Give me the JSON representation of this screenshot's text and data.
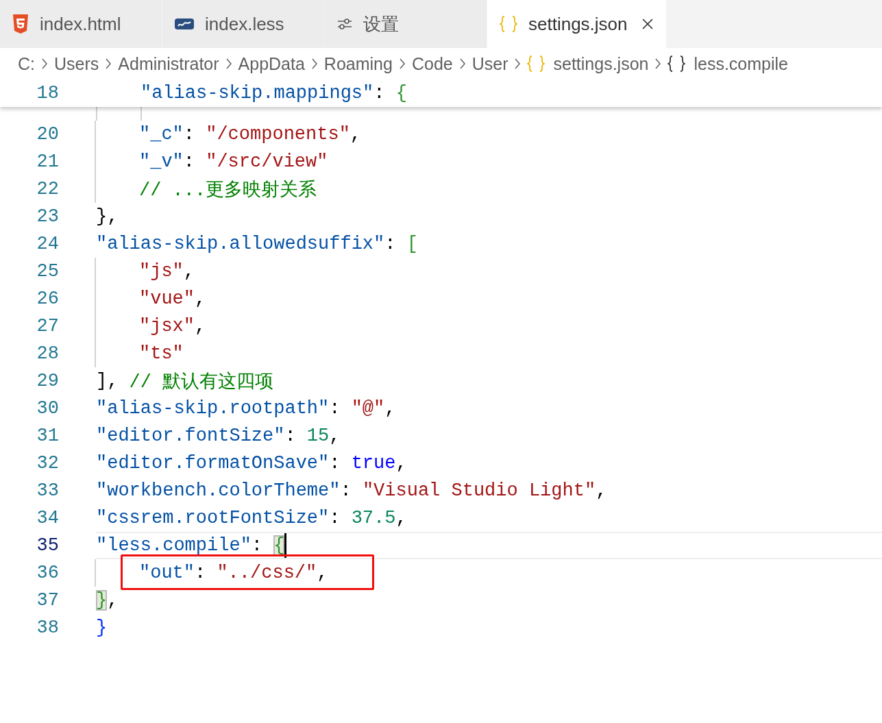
{
  "tabs": [
    {
      "label": "index.html",
      "kind": "html",
      "selected": false,
      "closable": false
    },
    {
      "label": "index.less",
      "kind": "less",
      "selected": false,
      "closable": false
    },
    {
      "label": "设置",
      "kind": "settings",
      "selected": false,
      "closable": false
    },
    {
      "label": "settings.json",
      "kind": "json",
      "selected": true,
      "closable": true
    }
  ],
  "breadcrumbs": [
    {
      "label": "C:",
      "kind": "folder"
    },
    {
      "label": "Users",
      "kind": "folder"
    },
    {
      "label": "Administrator",
      "kind": "folder"
    },
    {
      "label": "AppData",
      "kind": "folder"
    },
    {
      "label": "Roaming",
      "kind": "folder"
    },
    {
      "label": "Code",
      "kind": "folder"
    },
    {
      "label": "User",
      "kind": "folder"
    },
    {
      "label": "settings.json",
      "kind": "json"
    },
    {
      "label": "less.compile",
      "kind": "object"
    }
  ],
  "sticky_line": {
    "number": "18",
    "tokens": [
      {
        "kind": "key",
        "text": "\"alias-skip.mappings\""
      },
      {
        "kind": "punct",
        "text": ": "
      },
      {
        "kind": "open",
        "text": "{",
        "color": "#319331",
        "matched": false
      }
    ]
  },
  "lines": [
    {
      "number": "20",
      "selected": false,
      "boxed": false,
      "cursor": false,
      "tokens": [
        {
          "kind": "key",
          "text": "\"_c\""
        },
        {
          "kind": "punct",
          "text": ": "
        },
        {
          "kind": "string",
          "text": "\"/components\""
        },
        {
          "kind": "punct",
          "text": ","
        }
      ]
    },
    {
      "number": "21",
      "selected": false,
      "boxed": false,
      "cursor": false,
      "tokens": [
        {
          "kind": "key",
          "text": "\"_v\""
        },
        {
          "kind": "punct",
          "text": ": "
        },
        {
          "kind": "string",
          "text": "\"/src/view\""
        }
      ]
    },
    {
      "number": "22",
      "selected": false,
      "boxed": false,
      "cursor": false,
      "tokens": [
        {
          "kind": "comment",
          "text": "// ...更多映射关系"
        }
      ]
    },
    {
      "number": "23",
      "selected": false,
      "boxed": false,
      "cursor": false,
      "tokens": [
        {
          "kind": "close",
          "text": "}",
          "color": "#000000",
          "matched": false
        },
        {
          "kind": "punct",
          "text": ","
        }
      ]
    },
    {
      "number": "24",
      "selected": false,
      "boxed": false,
      "cursor": false,
      "tokens": [
        {
          "kind": "key",
          "text": "\"alias-skip.allowedsuffix\""
        },
        {
          "kind": "punct",
          "text": ": "
        },
        {
          "kind": "open",
          "text": "[",
          "color": "#319331",
          "matched": false
        }
      ]
    },
    {
      "number": "25",
      "selected": false,
      "boxed": false,
      "cursor": false,
      "tokens": [
        {
          "kind": "string",
          "text": "\"js\""
        },
        {
          "kind": "punct",
          "text": ","
        }
      ]
    },
    {
      "number": "26",
      "selected": false,
      "boxed": false,
      "cursor": false,
      "tokens": [
        {
          "kind": "string",
          "text": "\"vue\""
        },
        {
          "kind": "punct",
          "text": ","
        }
      ]
    },
    {
      "number": "27",
      "selected": false,
      "boxed": false,
      "cursor": false,
      "tokens": [
        {
          "kind": "string",
          "text": "\"jsx\""
        },
        {
          "kind": "punct",
          "text": ","
        }
      ]
    },
    {
      "number": "28",
      "selected": false,
      "boxed": false,
      "cursor": false,
      "tokens": [
        {
          "kind": "string",
          "text": "\"ts\""
        }
      ]
    },
    {
      "number": "29",
      "selected": false,
      "boxed": false,
      "cursor": false,
      "tokens": [
        {
          "kind": "close",
          "text": "]",
          "color": "#000000",
          "matched": false
        },
        {
          "kind": "punct",
          "text": ", "
        },
        {
          "kind": "comment",
          "text": "// 默认有这四项"
        }
      ]
    },
    {
      "number": "30",
      "selected": false,
      "boxed": false,
      "cursor": false,
      "tokens": [
        {
          "kind": "key",
          "text": "\"alias-skip.rootpath\""
        },
        {
          "kind": "punct",
          "text": ": "
        },
        {
          "kind": "string",
          "text": "\"@\""
        },
        {
          "kind": "punct",
          "text": ","
        }
      ]
    },
    {
      "number": "31",
      "selected": false,
      "boxed": false,
      "cursor": false,
      "tokens": [
        {
          "kind": "key",
          "text": "\"editor.fontSize\""
        },
        {
          "kind": "punct",
          "text": ": "
        },
        {
          "kind": "number",
          "text": "15"
        },
        {
          "kind": "punct",
          "text": ","
        }
      ]
    },
    {
      "number": "32",
      "selected": false,
      "boxed": false,
      "cursor": false,
      "tokens": [
        {
          "kind": "key",
          "text": "\"editor.formatOnSave\""
        },
        {
          "kind": "punct",
          "text": ": "
        },
        {
          "kind": "keyword",
          "text": "true"
        },
        {
          "kind": "punct",
          "text": ","
        }
      ]
    },
    {
      "number": "33",
      "selected": false,
      "boxed": false,
      "cursor": false,
      "tokens": [
        {
          "kind": "key",
          "text": "\"workbench.colorTheme\""
        },
        {
          "kind": "punct",
          "text": ": "
        },
        {
          "kind": "string",
          "text": "\"Visual Studio Light\""
        },
        {
          "kind": "punct",
          "text": ","
        }
      ]
    },
    {
      "number": "34",
      "selected": false,
      "boxed": false,
      "cursor": false,
      "tokens": [
        {
          "kind": "key",
          "text": "\"cssrem.rootFontSize\""
        },
        {
          "kind": "punct",
          "text": ": "
        },
        {
          "kind": "number",
          "text": "37.5"
        },
        {
          "kind": "punct",
          "text": ","
        }
      ]
    },
    {
      "number": "35",
      "selected": true,
      "boxed": false,
      "cursor": true,
      "tokens": [
        {
          "kind": "key",
          "text": "\"less.compile\""
        },
        {
          "kind": "punct",
          "text": ": "
        },
        {
          "kind": "open",
          "text": "{",
          "color": "#319331",
          "matched": true
        }
      ]
    },
    {
      "number": "36",
      "selected": false,
      "boxed": true,
      "cursor": false,
      "tokens": [
        {
          "kind": "key",
          "text": "\"out\""
        },
        {
          "kind": "punct",
          "text": ": "
        },
        {
          "kind": "string",
          "text": "\"../css/\""
        },
        {
          "kind": "punct",
          "text": ","
        }
      ]
    },
    {
      "number": "37",
      "selected": false,
      "boxed": false,
      "cursor": false,
      "tokens": [
        {
          "kind": "close",
          "text": "}",
          "color": "#319331",
          "matched": true
        },
        {
          "kind": "punct",
          "text": ","
        }
      ]
    },
    {
      "number": "38",
      "selected": false,
      "boxed": false,
      "cursor": false,
      "tokens": [
        {
          "kind": "close",
          "text": "}",
          "color": "#0431fa",
          "matched": false
        }
      ]
    }
  ]
}
